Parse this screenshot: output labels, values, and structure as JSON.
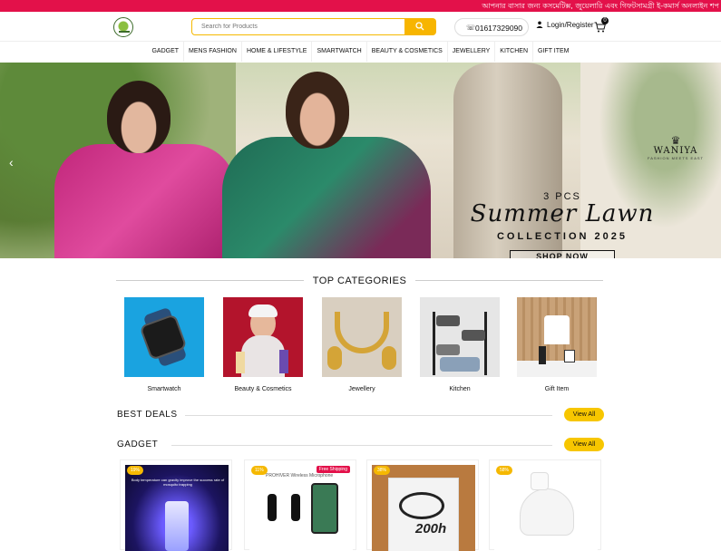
{
  "topbar": {
    "marquee": "আপনার বাসার জন্য কসমেটিক্স, জুয়েলারি এবং গিফটসামগ্রী ই-কমার্স অনলাইন শপ"
  },
  "header": {
    "search_placeholder": "Search for Products",
    "phone": "01617329090",
    "login": "Login/Register",
    "cart_count": "0"
  },
  "nav": {
    "items": [
      "GADGET",
      "MENS FASHION",
      "HOME & LIFESTYLE",
      "SMARTWATCH",
      "BEAUTY & COSMETICS",
      "JEWELLERY",
      "KITCHEN",
      "GIFT ITEM"
    ]
  },
  "banner": {
    "brand": "WANIYA",
    "brand_sub": "FASHION MEETS EAST",
    "pcs": "3 PCS",
    "script": "Summer Lawn",
    "collection": "COLLECTION 2025",
    "cta": "SHOP NOW",
    "prev": "‹",
    "next": "›"
  },
  "categories": {
    "title": "TOP CATEGORIES",
    "items": [
      {
        "label": "Smartwatch",
        "color": "#1aa3e0"
      },
      {
        "label": "Beauty & Cosmetics",
        "color": "#b3142c"
      },
      {
        "label": "Jewellery",
        "color": "#d9cfc0"
      },
      {
        "label": "Kitchen",
        "color": "#d4d4d4"
      },
      {
        "label": "Gift Item",
        "color": "#c9a278"
      }
    ]
  },
  "best_deals": {
    "title": "BEST DEALS",
    "view_all": "View All"
  },
  "gadget": {
    "title": "GADGET",
    "view_all": "View All",
    "products": [
      {
        "discount": "19%",
        "caption": "Body temperature can gravity improve the success rate of mosquito trapping"
      },
      {
        "discount": "11%",
        "free_shipping": "Free Shipping",
        "caption": "PROHIVER Wireless Microphone"
      },
      {
        "discount": "38%",
        "caption": "200h"
      },
      {
        "discount": "58%"
      }
    ]
  },
  "colors": {
    "accent_red": "#e3114a",
    "accent_yellow": "#f7c600"
  }
}
